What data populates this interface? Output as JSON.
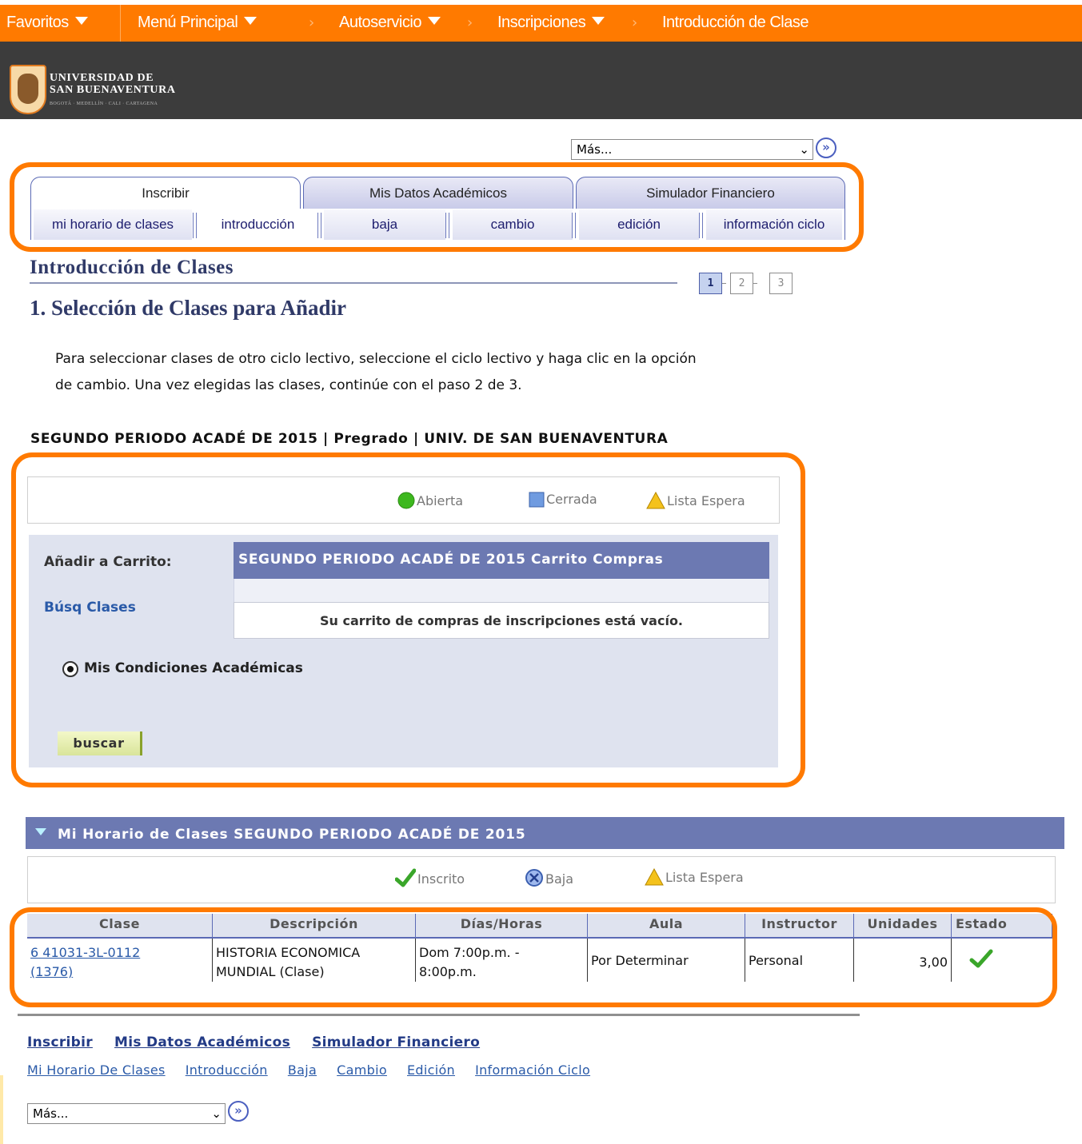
{
  "topnav": {
    "favoritos": "Favoritos",
    "menu_principal": "Menú Principal",
    "autoservicio": "Autoservicio",
    "inscripciones": "Inscripciones",
    "current": "Introducción de Clase",
    "separator": "›"
  },
  "banner": {
    "line1": "UNIVERSIDAD DE",
    "line2": "SAN BUENAVENTURA",
    "line3": "BOGOTÁ · MEDELLÍN · CALI · CARTAGENA",
    "accent": "#ff7a00"
  },
  "mas_select": {
    "value": "Más...",
    "chevron": "⌄",
    "go": "»"
  },
  "tabs": [
    "Inscribir",
    "Mis Datos Académicos",
    "Simulador Financiero"
  ],
  "subtabs": [
    "mi horario de clases",
    "introducción",
    "baja",
    "cambio",
    "edición",
    "información ciclo"
  ],
  "page": {
    "title": "Introducción de Clases",
    "steps": [
      "1",
      "2",
      "3"
    ],
    "subtitle": "1. Selección de Clases para Añadir",
    "intro_line1": "Para seleccionar clases de otro ciclo lectivo, seleccione el ciclo lectivo y haga clic en la opción",
    "intro_line2": "de cambio. Una vez elegidas las clases, continúe con el paso 2 de 3.",
    "period": "SEGUNDO PERIODO ACADÉ DE 2015 | Pregrado | UNIV. DE SAN BUENAVENTURA"
  },
  "legend1": {
    "open": "Abierta",
    "closed": "Cerrada",
    "wait": "Lista Espera"
  },
  "cart": {
    "add_label": "Añadir a Carrito:",
    "search_link": "Búsq Clases",
    "header": "SEGUNDO PERIODO ACADÉ DE 2015 Carrito Compras",
    "empty": "Su carrito de compras de inscripciones está vacío.",
    "radio_label": "Mis Condiciones Académicas",
    "search_button": "buscar"
  },
  "schedule": {
    "header": "Mi Horario de Clases SEGUNDO PERIODO ACADÉ DE 2015",
    "legend": {
      "enrolled": "Inscrito",
      "dropped": "Baja",
      "wait": "Lista Espera"
    },
    "columns": [
      "Clase",
      "Descripción",
      "Días/Horas",
      "Aula",
      "Instructor",
      "Unidades",
      "Estado"
    ],
    "row": {
      "clase_line1": "6 41031-3L-0112",
      "clase_line2": "(1376)",
      "desc_line1": "HISTORIA ECONOMICA",
      "desc_line2": "MUNDIAL (Clase)",
      "time_line1": "Dom 7:00p.m. -",
      "time_line2": "8:00p.m.",
      "aula": "Por Determinar",
      "instructor": "Personal",
      "unidades": "3,00",
      "estado_icon": "check-icon"
    }
  },
  "footer": {
    "main_links": [
      "Inscribir",
      "Mis Datos Académicos",
      "Simulador Financiero"
    ],
    "sub_links": [
      "Mi Horario De Clases",
      "Introducción",
      "Baja",
      "Cambio",
      "Edición",
      "Información Ciclo"
    ]
  }
}
